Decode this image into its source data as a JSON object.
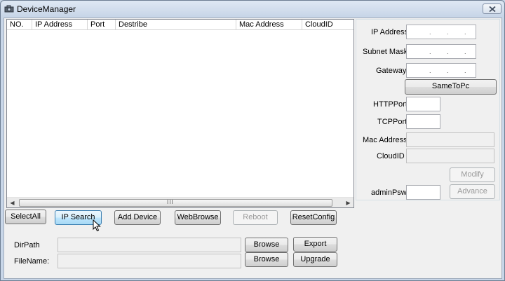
{
  "window": {
    "title": "DeviceManager"
  },
  "list": {
    "columns": [
      "NO.",
      "IP Address",
      "Port",
      "Destribe",
      "Mac Address",
      "CloudID"
    ],
    "rows": []
  },
  "bottom_buttons": {
    "select_all": "SelectAll",
    "ip_search": "IP Search",
    "add_device": "Add Device",
    "web_browse": "WebBrowse",
    "reboot": "Reboot",
    "reset_config": "ResetConfig"
  },
  "paths": {
    "dir_label": "DirPath",
    "file_label": "FileName:",
    "dir_value": "",
    "file_value": "",
    "browse_label": "Browse",
    "export_label": "Export",
    "upgrade_label": "Upgrade"
  },
  "panel": {
    "ip_label": "IP Address",
    "mask_label": "Subnet Mask",
    "gateway_label": "Gateway",
    "same_to_pc": "SameToPc",
    "http_port_label": "HTTPPort",
    "tcp_port_label": "TCPPort",
    "mac_label": "Mac Address",
    "cloud_label": "CloudID",
    "modify": "Modify",
    "advance": "Advance",
    "admin_psw_label": "adminPsw",
    "ip_dot": "."
  },
  "scrollbar": {
    "grip": "III"
  }
}
